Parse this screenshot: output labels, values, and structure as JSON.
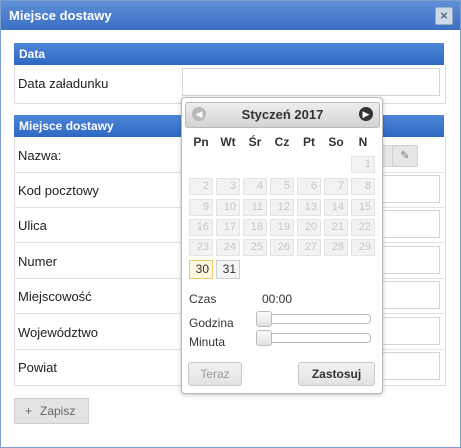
{
  "dialog": {
    "title": "Miejsce dostawy",
    "close_icon": "×"
  },
  "section_data": {
    "header": "Data",
    "rows": [
      {
        "label": "Data załadunku"
      }
    ]
  },
  "section_place": {
    "header": "Miejsce dostawy",
    "rows": [
      {
        "label": "Nazwa:"
      },
      {
        "label": "Kod pocztowy"
      },
      {
        "label": "Ulica"
      },
      {
        "label": "Numer"
      },
      {
        "label": "Miejscowość"
      },
      {
        "label": "Województwo"
      },
      {
        "label": "Powiat"
      }
    ],
    "edit_icon": "✎"
  },
  "save_button": {
    "icon": "+",
    "label": "Zapisz"
  },
  "datepicker": {
    "title": "Styczeń 2017",
    "prev_icon": "◀",
    "next_icon": "▶",
    "weekdays": [
      "Pn",
      "Wt",
      "Śr",
      "Cz",
      "Pt",
      "So",
      "N"
    ],
    "weeks": [
      [
        "",
        "",
        "",
        "",
        "",
        "",
        "1"
      ],
      [
        "2",
        "3",
        "4",
        "5",
        "6",
        "7",
        "8"
      ],
      [
        "9",
        "10",
        "11",
        "12",
        "13",
        "14",
        "15"
      ],
      [
        "16",
        "17",
        "18",
        "19",
        "20",
        "21",
        "22"
      ],
      [
        "23",
        "24",
        "25",
        "26",
        "27",
        "28",
        "29"
      ],
      [
        "30",
        "31",
        "",
        "",
        "",
        "",
        ""
      ]
    ],
    "selectable_days": [
      "30",
      "31"
    ],
    "today": "30",
    "time_label": "Czas",
    "time_value": "00:00",
    "hour_label": "Godzina",
    "minute_label": "Minuta",
    "hour_value": 0,
    "minute_value": 0,
    "now_button": "Teraz",
    "apply_button": "Zastosuj"
  }
}
